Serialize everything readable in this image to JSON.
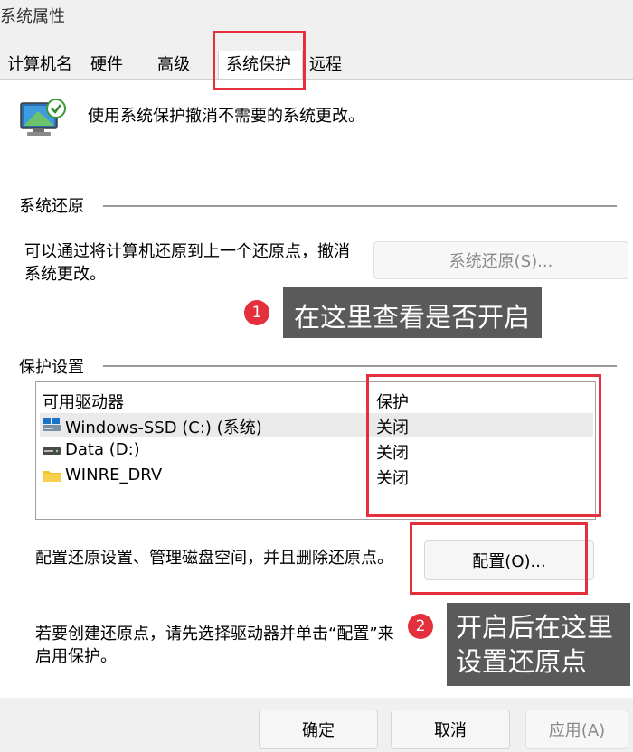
{
  "window": {
    "title": "系统属性"
  },
  "tabs": [
    {
      "label": "计算机名"
    },
    {
      "label": "硬件"
    },
    {
      "label": "高级"
    },
    {
      "label": "系统保护"
    },
    {
      "label": "远程"
    }
  ],
  "intro": {
    "text": "使用系统保护撤消不需要的系统更改。"
  },
  "restore": {
    "heading": "系统还原",
    "description_line1": "可以通过将计算机还原到上一个还原点，撤消",
    "description_line2": "系统更改。",
    "button_label": "系统还原(S)..."
  },
  "protection": {
    "heading": "保护设置",
    "columns": [
      "可用驱动器",
      "保护"
    ],
    "drives": [
      {
        "name": "Windows-SSD (C:) (系统)",
        "status": "关闭",
        "icon": "system-drive-icon"
      },
      {
        "name": "Data (D:)",
        "status": "关闭",
        "icon": "drive-icon"
      },
      {
        "name": "WINRE_DRV",
        "status": "关闭",
        "icon": "folder-icon"
      }
    ],
    "config_text": "配置还原设置、管理磁盘空间，并且删除还原点。",
    "config_button": "配置(O)...",
    "create_text_line1": "若要创建还原点，请先选择驱动器并单击“配置”来",
    "create_text_line2": "启用保护。"
  },
  "annotations": {
    "badge1": "1",
    "callout1": "在这里查看是否开启",
    "badge2": "2",
    "callout2_line1": "开启后在这里",
    "callout2_line2": "设置还原点",
    "red_color": "#e42f3c",
    "callout_bg": "#5a5a5a"
  },
  "footer": {
    "ok": "确定",
    "cancel": "取消",
    "apply": "应用(A)"
  }
}
